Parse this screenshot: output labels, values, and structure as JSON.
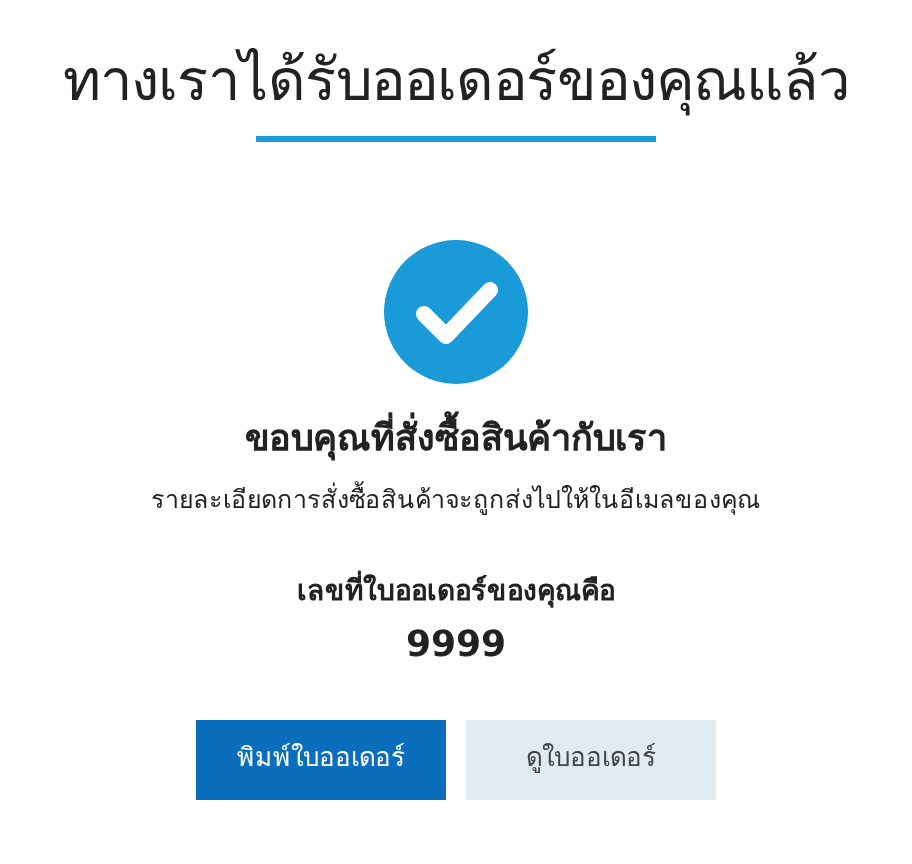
{
  "title": "ทางเราได้รับออเดอร์ของคุณแล้ว",
  "heading": "ขอบคุณที่สั่งซื้อสินค้ากับเรา",
  "message": "รายละเอียดการสั่งซื้อสินค้าจะถูกส่งไปให้ในอีเมลของคุณ",
  "order_label": "เลขที่ใบออเดอร์ของคุณคือ",
  "order_number": "9999",
  "buttons": [
    {
      "label": "พิมพ์ใบออเดอร์",
      "kind": "primary"
    },
    {
      "label": "ดูใบออเดอร์",
      "kind": "secondary"
    }
  ]
}
